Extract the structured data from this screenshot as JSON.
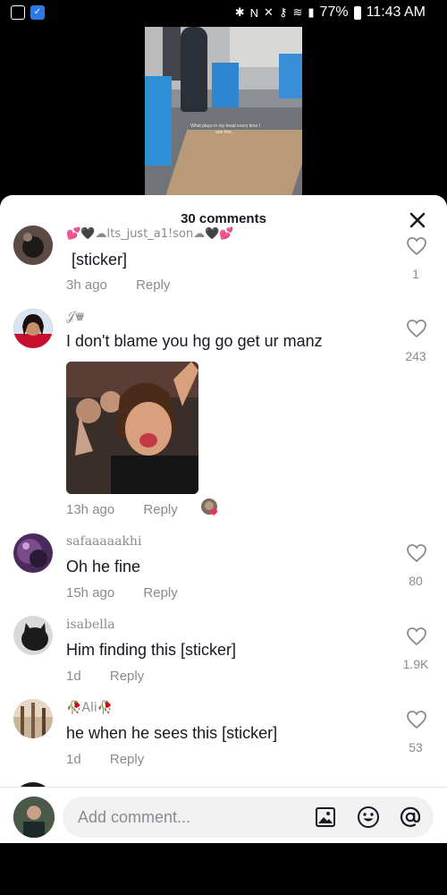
{
  "status_bar": {
    "battery": "77%",
    "time": "11:43 AM"
  },
  "video": {
    "caption": "What plays in my head every time I see him..."
  },
  "sheet": {
    "title": "30 comments"
  },
  "comments": [
    {
      "username": "💕🖤☁Its_just_a1!son☁🖤💕",
      "text": "[sticker]",
      "time": "3h ago",
      "reply_label": "Reply",
      "likes": "1"
    },
    {
      "username": "𝒥♛",
      "text": "I don't blame you hg go get ur manz",
      "time": "13h ago",
      "reply_label": "Reply",
      "likes": "243"
    },
    {
      "username": "safaaaaakhi",
      "text": "Oh he fine",
      "time": "15h ago",
      "reply_label": "Reply",
      "likes": "80"
    },
    {
      "username": "isabella",
      "text": "Him finding this [sticker]",
      "time": "1d",
      "reply_label": "Reply",
      "likes": "1.9K"
    },
    {
      "username": "🥀Ali🥀",
      "text": "he when he sees this [sticker]",
      "time": "1d",
      "reply_label": "Reply",
      "likes": "53"
    }
  ],
  "input": {
    "placeholder": "Add comment..."
  },
  "icons": {
    "close": "close-icon",
    "like": "heart-outline-icon",
    "image": "image-icon",
    "emoji": "emoji-icon",
    "mention": "at-icon"
  },
  "colors": {
    "accent_heart": "#fe2c55",
    "text_primary": "#161823",
    "text_secondary": "#8a8b91"
  }
}
